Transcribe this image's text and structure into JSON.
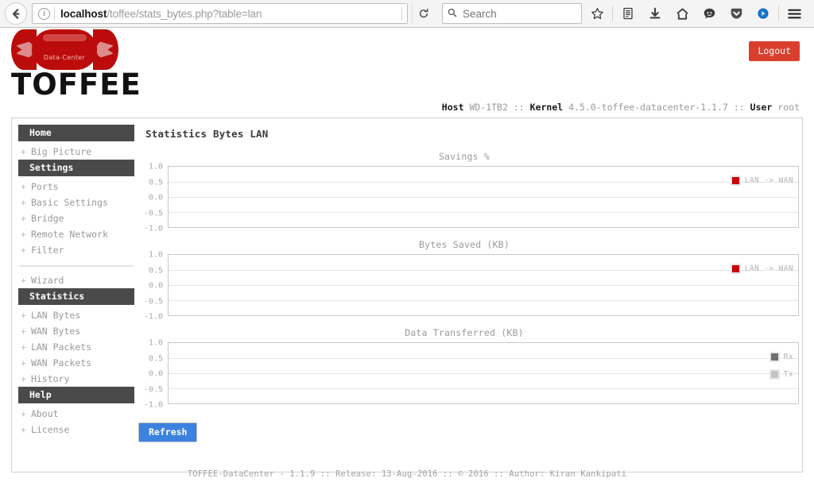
{
  "browser": {
    "back_icon": "back-arrow-icon",
    "info_icon": "page-info-icon",
    "url_host": "localhost",
    "url_path": "/toffee/stats_bytes.php?table=lan",
    "reload_icon": "reload-icon",
    "search_placeholder": "Search",
    "search_value": "",
    "search_icon": "search-icon",
    "toolbar_icons": [
      {
        "name": "bookmark-star-icon",
        "glyph": "☆"
      },
      {
        "name": "library-icon",
        "glyph": "ὌB"
      },
      {
        "name": "downloads-icon",
        "glyph": "⬇"
      },
      {
        "name": "home-icon",
        "glyph": "⌂"
      },
      {
        "name": "hello-chat-icon",
        "glyph": "☺"
      },
      {
        "name": "pocket-icon",
        "glyph": "▼"
      },
      {
        "name": "sync-account-icon",
        "glyph": "●"
      },
      {
        "name": "hamburger-menu-icon",
        "glyph": "☰"
      }
    ]
  },
  "header": {
    "logo_word": "TOFFEE",
    "logo_candy_label": "Data-Center",
    "logout_label": "Logout",
    "host_label": "Host",
    "host_value": "WD-1TB2",
    "sep1": "::",
    "kernel_label": "Kernel",
    "kernel_value": "4.5.0-toffee-datacenter-1.1.7",
    "sep2": "::",
    "user_label": "User",
    "user_value": "root"
  },
  "sidebar": {
    "groups": [
      {
        "section": "Home",
        "items": [
          {
            "label": "Big Picture"
          }
        ]
      },
      {
        "section": "Settings",
        "items": [
          {
            "label": "Ports"
          },
          {
            "label": "Basic Settings"
          },
          {
            "label": "Bridge"
          },
          {
            "label": "Remote Network"
          },
          {
            "label": "Filter"
          }
        ],
        "divider_after": true,
        "extra_items": [
          {
            "label": "Wizard"
          }
        ]
      },
      {
        "section": "Statistics",
        "items": [
          {
            "label": "LAN Bytes"
          },
          {
            "label": "WAN Bytes"
          },
          {
            "label": "LAN Packets"
          },
          {
            "label": "WAN Packets"
          },
          {
            "label": "History"
          }
        ]
      },
      {
        "section": "Help",
        "items": [
          {
            "label": "About"
          },
          {
            "label": "License"
          }
        ]
      }
    ],
    "expand_glyph": "+"
  },
  "main": {
    "page_title": "Statistics Bytes LAN",
    "refresh_label": "Refresh"
  },
  "chart_data": [
    {
      "type": "line",
      "title": "Savings %",
      "xlabel": "",
      "ylabel": "",
      "ylim": [
        -1.0,
        1.0
      ],
      "yticks": [
        "1.0",
        "0.5",
        "0.0",
        "-0.5",
        "-1.0"
      ],
      "gridlines": [
        "0.5",
        "0.0",
        "-0.5"
      ],
      "grid": true,
      "legend_position": "top-right",
      "series": [
        {
          "name": "LAN -> WAN",
          "color": "#cc0000",
          "values": []
        }
      ],
      "x": [],
      "empty": true
    },
    {
      "type": "line",
      "title": "Bytes Saved (KB)",
      "xlabel": "",
      "ylabel": "",
      "ylim": [
        -1.0,
        1.0
      ],
      "yticks": [
        "1.0",
        "0.5",
        "0.0",
        "-0.5",
        "-1.0"
      ],
      "gridlines": [
        "0.5",
        "0.0",
        "-0.5"
      ],
      "grid": true,
      "legend_position": "top-right",
      "series": [
        {
          "name": "LAN -> WAN",
          "color": "#cc0000",
          "values": []
        }
      ],
      "x": [],
      "empty": true
    },
    {
      "type": "line",
      "title": "Data Transferred (KB)",
      "xlabel": "",
      "ylabel": "",
      "ylim": [
        -1.0,
        1.0
      ],
      "yticks": [
        "1.0",
        "0.5",
        "0.0",
        "-0.5",
        "-1.0"
      ],
      "gridlines": [
        "0.5",
        "0.0",
        "-0.5"
      ],
      "grid": true,
      "legend_position": "top-right",
      "series": [
        {
          "name": "Rx",
          "color": "#707070",
          "values": []
        },
        {
          "name": "Tx",
          "color": "#c4c4c4",
          "values": []
        }
      ],
      "x": [],
      "empty": true
    }
  ],
  "footer": {
    "text": "TOFFEE-DataCenter - 1.1.9 :: Release: 13-Aug-2016 :: © 2016 :: Author: Kiran Kankipati"
  },
  "colors": {
    "brand_red": "#bb0b0b",
    "logout_red": "#d93f2e",
    "refresh_blue": "#3b82e0",
    "nav_header": "#4a4a4a"
  }
}
